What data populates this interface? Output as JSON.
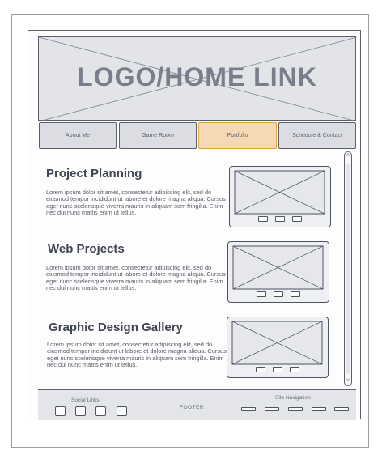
{
  "header": {
    "logo_text": "LOGO/HOME LINK"
  },
  "nav": {
    "items": [
      {
        "label": "About Me"
      },
      {
        "label": "Game Room"
      },
      {
        "label": "Portfolio"
      },
      {
        "label": "Schedule & Contact"
      }
    ],
    "active_index": 2,
    "accent_color": "#e8a23a"
  },
  "sections": [
    {
      "title": "Project Planning",
      "body": "Lorem ipsum dolor sit amet, consectetur adipiscing elit, sed do eiusmod tempor incididunt ut labore et dolore magna aliqua. Cursus eget nunc scelerisque viverra mauris in aliquam sem fringilla. Enim nec dui nunc mattis enim ut tellus."
    },
    {
      "title": "Web Projects",
      "body": "Lorem ipsum dolor sit amet, consectetur adipiscing elit, sed do eiusmod tempor incididunt ut labore et dolore magna aliqua. Cursus eget nunc scelerisque viverra mauris in aliquam sem fringilla. Enim nec dui nunc mattis enim ut tellus."
    },
    {
      "title": "Graphic Design Gallery",
      "body": "Lorem ipsum dolor sit amet, consectetur adipiscing elit, sed do eiusmod tempor incididunt ut labore et dolore magna aliqua. Cursus eget nunc scelerisque viverra mauris in aliquam sem fringilla. Enim nec dui nunc mattis enim ut tellus."
    }
  ],
  "footer": {
    "social_label": "Social Links",
    "center_label": "FOOTER",
    "site_nav_label": "Site Navigation"
  }
}
